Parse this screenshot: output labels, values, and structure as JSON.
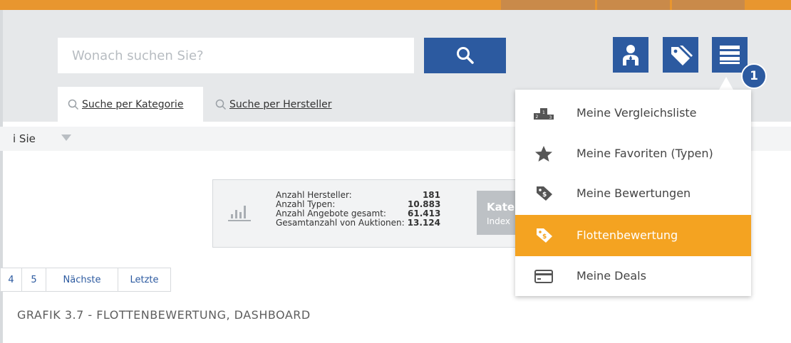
{
  "header": {
    "search": {
      "placeholder": "Wonach suchen Sie?"
    },
    "icons": [
      "dealer-icon",
      "tags-icon",
      "menu-icon"
    ],
    "badge": "1"
  },
  "tabs": [
    {
      "label": "Suche per Kategorie",
      "active": true
    },
    {
      "label": "Suche per Hersteller",
      "active": false
    }
  ],
  "filter": {
    "partial_text": "i Sie"
  },
  "stats": {
    "rows": [
      {
        "label": "Anzahl Hersteller:",
        "value": "181"
      },
      {
        "label": "Anzahl Typen:",
        "value": "10.883"
      },
      {
        "label": "Anzahl Angebote gesamt:",
        "value": "61.413"
      },
      {
        "label": "Gesamtanzahl von Auktionen:",
        "value": "13.124"
      }
    ],
    "category_button": {
      "title": "Kate",
      "subtitle": "Index"
    }
  },
  "pagination": [
    "4",
    "5",
    "Nächste",
    "Letzte"
  ],
  "dropdown": {
    "items": [
      {
        "label": "Meine Vergleichsliste",
        "icon": "podium-icon",
        "active": false
      },
      {
        "label": "Meine Favoriten (Typen)",
        "icon": "star-icon",
        "active": false
      },
      {
        "label": "Meine Bewertungen",
        "icon": "price-tag-icon",
        "active": false
      },
      {
        "label": "Flottenbewertung",
        "icon": "price-tag-icon",
        "active": true
      },
      {
        "label": "Meine Deals",
        "icon": "credit-card-icon",
        "active": false
      }
    ]
  },
  "caption": "GRAFIK 3.7 - FLOTTENBEWERTUNG, DASHBOARD",
  "colors": {
    "brand_blue": "#2c5aa0",
    "accent_orange": "#f4a321",
    "top_bar": "#e8962f"
  }
}
